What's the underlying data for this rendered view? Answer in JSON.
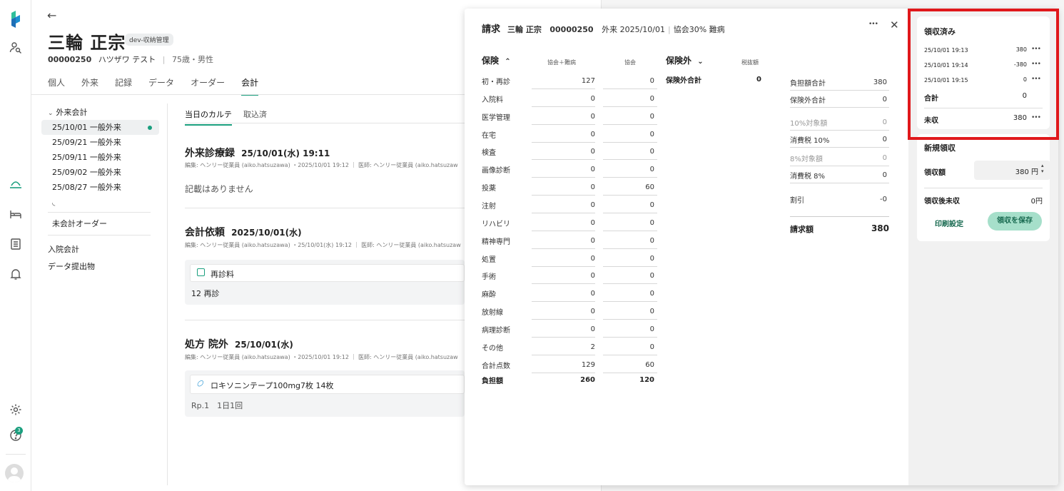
{
  "patient": {
    "name": "三輪 正宗",
    "env_badge": "dev-収納管理",
    "id": "00000250",
    "kana": "ハツザワ テスト",
    "age_sex": "75歳・男性"
  },
  "tabs": [
    "個人",
    "外来",
    "記録",
    "データ",
    "オーダー",
    "会計"
  ],
  "active_tab": "会計",
  "tree": {
    "group": "外来会計",
    "items": [
      "25/10/01 一般外来",
      "25/09/21 一般外来",
      "25/09/11 一般外来",
      "25/09/02 一般外来",
      "25/08/27 一般外来"
    ],
    "unbilled": "未会計オーダー",
    "inpatient": "入院会計",
    "data_export": "データ提出物"
  },
  "subtabs": [
    "当日のカルテ",
    "取込済"
  ],
  "sections": {
    "record": {
      "title": "外来診療録",
      "date": "25/10/01(水) 19:11",
      "meta": "編集: ヘンリー従業員 (aiko.hatsuzawa) ・2025/10/01 19:12 ｜ 医師: ヘンリー従業員 (aiko.hatsuzaw",
      "empty": "記載はありません"
    },
    "request": {
      "title": "会計依頼",
      "date": "2025/10/01(水)",
      "meta": "編集: ヘンリー従業員 (aiko.hatsuzawa) ・25/10/01(水) 19:12 ｜ 医師: ヘンリー従業員 (aiko.hatsuzaw",
      "item": "再診料",
      "detail": "12 再診"
    },
    "rx": {
      "title": "処方 院外",
      "date": "25/10/01(水)",
      "meta": "編集: ヘンリー従業員 (aiko.hatsuzawa) ・2025/10/01 19:12 ｜ 医師: ヘンリー従業員 (aiko.hatsuzaw",
      "item": "ロキソニンテープ100mg7枚 14枚",
      "detail": "Rp.1　1日1回"
    }
  },
  "billing": {
    "title": "請求",
    "patient": "三輪 正宗",
    "id": "00000250",
    "visit": "外来 2025/10/01",
    "insurance": "協会30% 難病",
    "insured_label": "保険",
    "col1": "協会＋難病",
    "col2": "協会",
    "rows": [
      {
        "label": "初・再診",
        "v1": "127",
        "v2": "0"
      },
      {
        "label": "入院料",
        "v1": "0",
        "v2": "0"
      },
      {
        "label": "医学管理",
        "v1": "0",
        "v2": "0"
      },
      {
        "label": "在宅",
        "v1": "0",
        "v2": "0"
      },
      {
        "label": "検査",
        "v1": "0",
        "v2": "0"
      },
      {
        "label": "画像診断",
        "v1": "0",
        "v2": "0"
      },
      {
        "label": "投薬",
        "v1": "0",
        "v2": "60"
      },
      {
        "label": "注射",
        "v1": "0",
        "v2": "0"
      },
      {
        "label": "リハビリ",
        "v1": "0",
        "v2": "0"
      },
      {
        "label": "精神専門",
        "v1": "0",
        "v2": "0"
      },
      {
        "label": "処置",
        "v1": "0",
        "v2": "0"
      },
      {
        "label": "手術",
        "v1": "0",
        "v2": "0"
      },
      {
        "label": "麻酔",
        "v1": "0",
        "v2": "0"
      },
      {
        "label": "放射線",
        "v1": "0",
        "v2": "0"
      },
      {
        "label": "病理診断",
        "v1": "0",
        "v2": "0"
      },
      {
        "label": "その他",
        "v1": "2",
        "v2": "0"
      },
      {
        "label": "合計点数",
        "v1": "129",
        "v2": "60"
      }
    ],
    "burden": {
      "label": "負担額",
      "v1": "260",
      "v2": "120"
    },
    "uninsured_label": "保険外",
    "tax_excl": "税抜額",
    "uninsured_total_label": "保険外合計",
    "uninsured_total": "0",
    "summary": [
      {
        "label": "負担額合計",
        "value": "380",
        "muted": false
      },
      {
        "label": "保険外合計",
        "value": "0",
        "muted": false
      },
      {
        "label": "10%対象額",
        "value": "0",
        "muted": true
      },
      {
        "label": "消費税 10%",
        "value": "0",
        "muted": false
      },
      {
        "label": "8%対象額",
        "value": "0",
        "muted": true
      },
      {
        "label": "消費税 8%",
        "value": "0",
        "muted": false
      },
      {
        "label": "割引",
        "value": "-0",
        "muted": false
      }
    ],
    "invoice_label": "請求額",
    "invoice_value": "380"
  },
  "receipts": {
    "title": "領収済み",
    "items": [
      {
        "time": "25/10/01 19:13",
        "amount": "380"
      },
      {
        "time": "25/10/01 19:14",
        "amount": "-380"
      },
      {
        "time": "25/10/01 19:15",
        "amount": "0"
      }
    ],
    "total_label": "合計",
    "total": "0",
    "unpaid_label": "未収",
    "unpaid": "380"
  },
  "new_receipt": {
    "title": "新規領収",
    "amount_label": "領収額",
    "amount": "380 円",
    "after_label": "領収後未収",
    "after_value": "0円",
    "print_settings": "印刷設定",
    "save": "領収を保存"
  },
  "colors": {
    "accent": "#1a9f7e",
    "highlight": "#e0181b"
  },
  "rail_badge": "3"
}
